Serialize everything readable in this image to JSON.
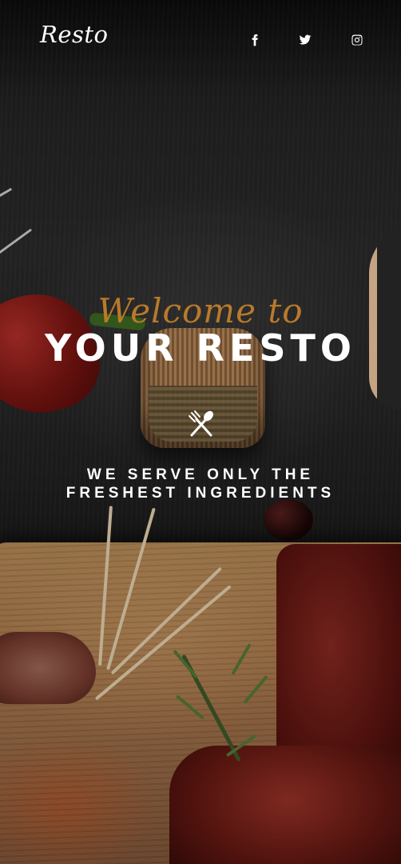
{
  "brand": {
    "logo_text": "Resto"
  },
  "social": [
    {
      "name": "facebook",
      "icon": "facebook-icon"
    },
    {
      "name": "twitter",
      "icon": "twitter-icon"
    },
    {
      "name": "instagram",
      "icon": "instagram-icon"
    }
  ],
  "hero": {
    "welcome": "Welcome to",
    "title": "YOUR RESTO",
    "divider_icon": "fork-spoon-icon",
    "tagline_line1": "WE SERVE ONLY THE",
    "tagline_line2": "FRESHEST INGREDIENTS"
  },
  "colors": {
    "accent": "#b97a2a",
    "text": "#ffffff",
    "background": "#2b2b2b"
  }
}
